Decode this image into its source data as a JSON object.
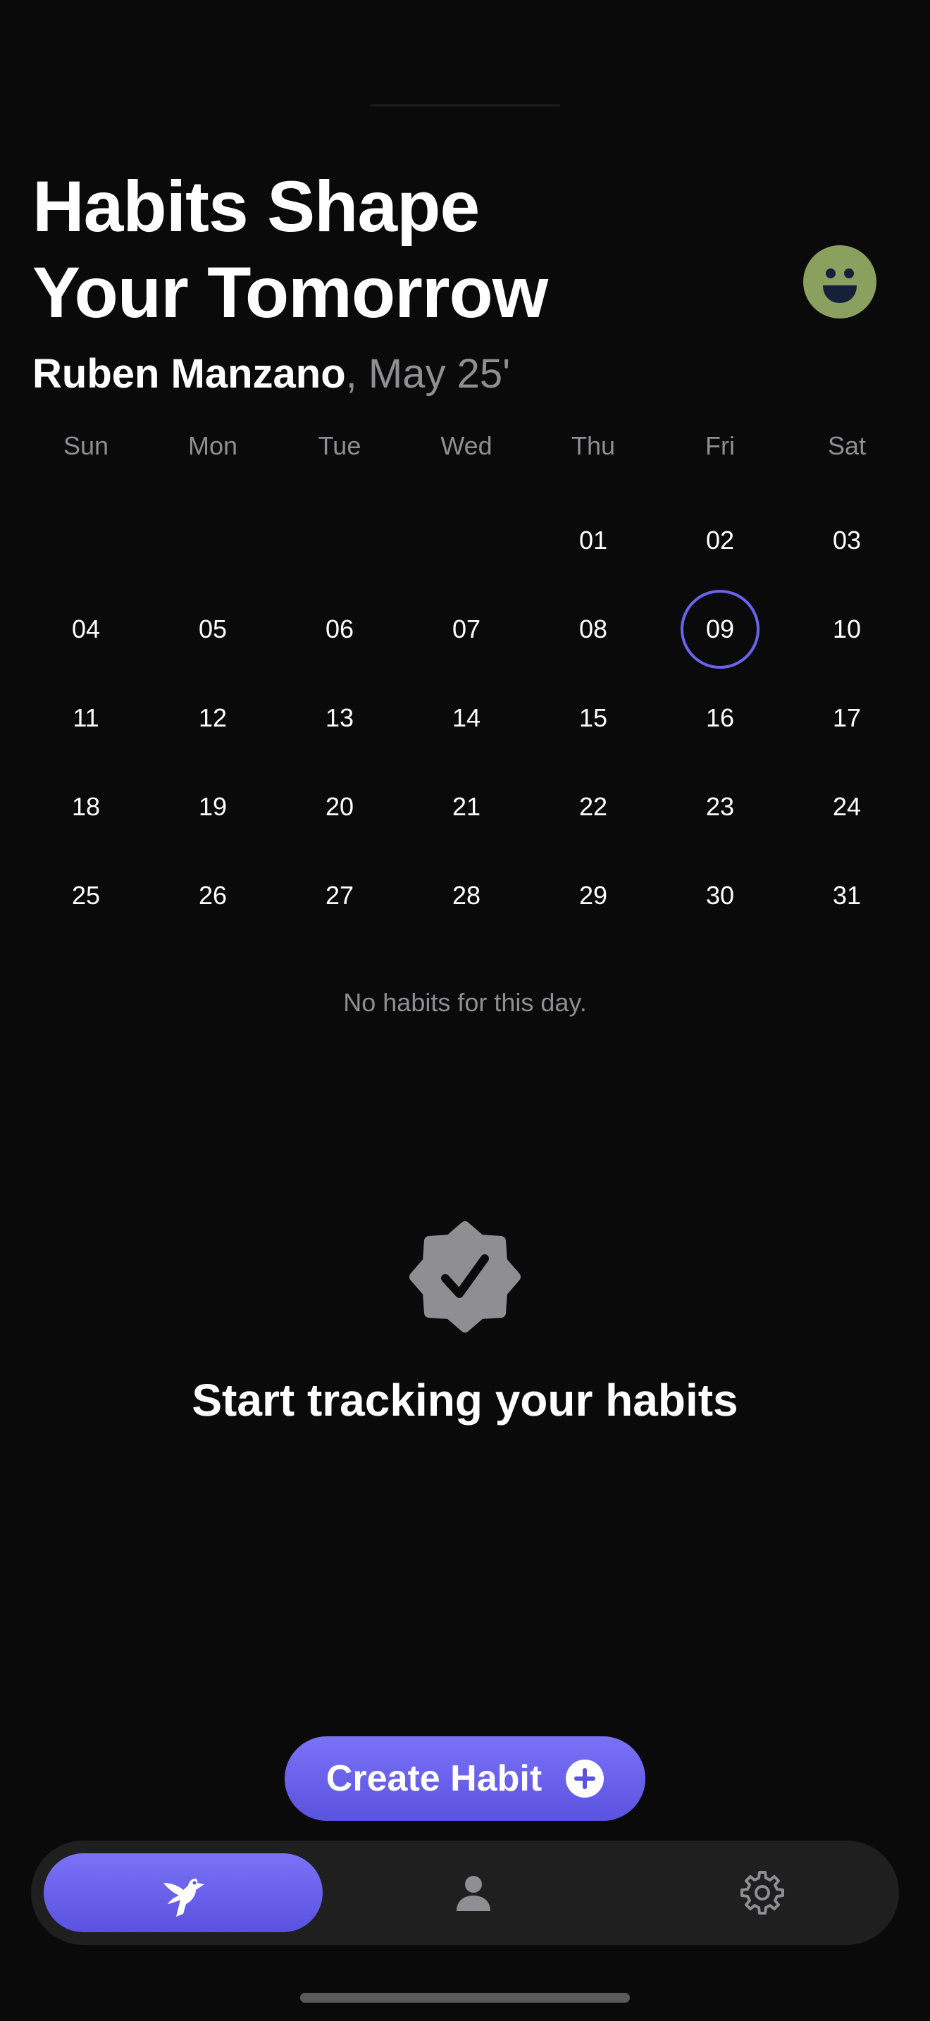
{
  "header": {
    "title_line1": "Habits Shape",
    "title_line2": "Your Tomorrow",
    "user_name": "Ruben Manzano",
    "date_suffix": ", May 25'",
    "avatar_icon": "smiley-face-icon"
  },
  "calendar": {
    "weekdays": [
      "Sun",
      "Mon",
      "Tue",
      "Wed",
      "Thu",
      "Fri",
      "Sat"
    ],
    "weeks": [
      [
        "",
        "",
        "",
        "",
        "01",
        "02",
        "03"
      ],
      [
        "04",
        "05",
        "06",
        "07",
        "08",
        "09",
        "10"
      ],
      [
        "11",
        "12",
        "13",
        "14",
        "15",
        "16",
        "17"
      ],
      [
        "18",
        "19",
        "20",
        "21",
        "22",
        "23",
        "24"
      ],
      [
        "25",
        "26",
        "27",
        "28",
        "29",
        "30",
        "31"
      ]
    ],
    "selected_day": "09"
  },
  "habits": {
    "empty_message": "No habits for this day."
  },
  "empty_state": {
    "icon": "checkmark-seal-icon",
    "title": "Start tracking your habits"
  },
  "actions": {
    "create_habit_label": "Create Habit"
  },
  "tabbar": {
    "tabs": [
      {
        "icon": "bird-icon",
        "active": true
      },
      {
        "icon": "person-icon",
        "active": false
      },
      {
        "icon": "gear-icon",
        "active": false
      }
    ]
  },
  "colors": {
    "background": "#0a0a0a",
    "accent": "#6b63f0",
    "avatar": "#8aa05f",
    "muted_text": "#8e8e93",
    "tabbar": "#1f1f1f"
  }
}
